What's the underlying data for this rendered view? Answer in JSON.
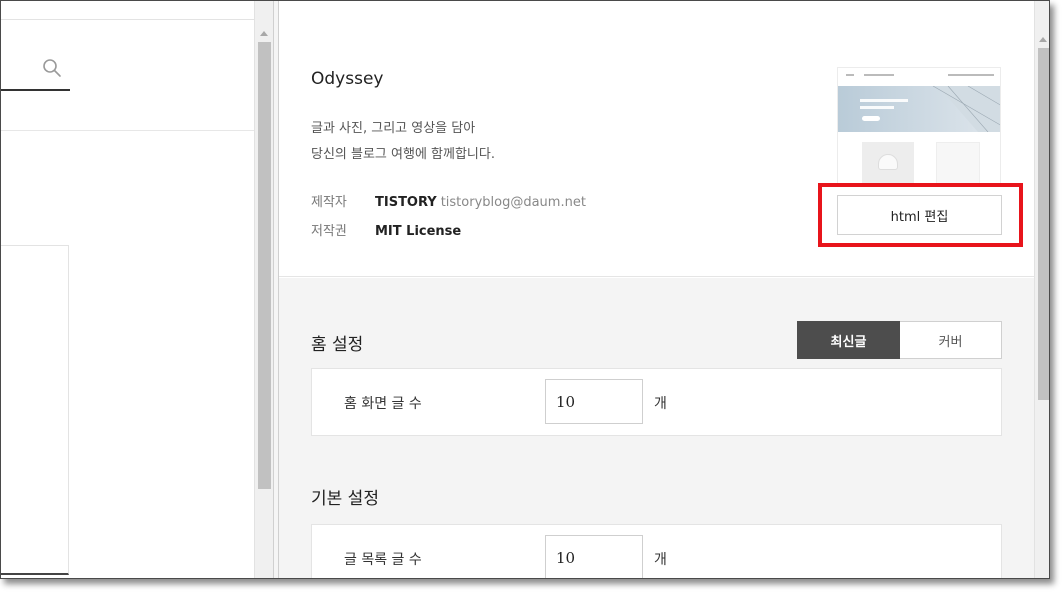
{
  "theme": {
    "name": "Odyssey",
    "description_line1": "글과 사진, 그리고 영상을 담아",
    "description_line2": "당신의 블로그 여행에 함께합니다.",
    "author_label": "제작자",
    "author_name": "TISTORY",
    "author_email": "tistoryblog@daum.net",
    "license_label": "저작권",
    "license_value": "MIT License",
    "edit_button_label": "html 편집"
  },
  "home_settings": {
    "title": "홈 설정",
    "tabs": [
      {
        "label": "최신글",
        "active": true
      },
      {
        "label": "커버",
        "active": false
      }
    ],
    "posts_label": "홈 화면 글 수",
    "posts_value": "10",
    "posts_unit": "개"
  },
  "basic_settings": {
    "title": "기본 설정",
    "list_label": "글 목록 글 수",
    "list_value": "10",
    "list_unit": "개"
  },
  "colors": {
    "highlight": "#e8141b",
    "active_tab": "#4d4d4d"
  },
  "icons": [
    "search-icon"
  ]
}
